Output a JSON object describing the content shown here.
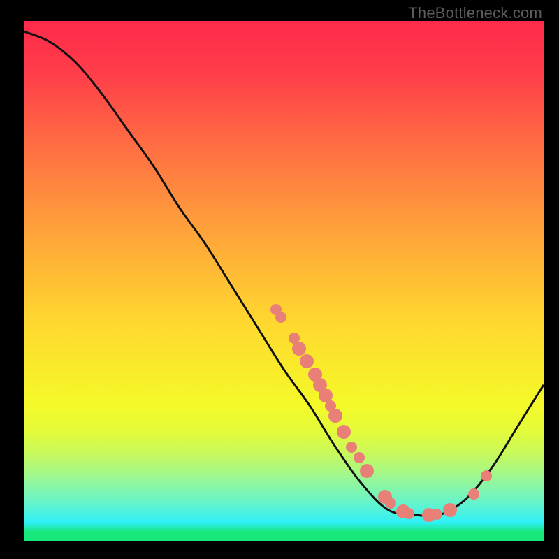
{
  "attribution": "TheBottleneck.com",
  "chart_data": {
    "type": "line",
    "title": "",
    "xlabel": "",
    "ylabel": "",
    "xlim": [
      0,
      100
    ],
    "ylim": [
      0,
      100
    ],
    "grid": false,
    "curve": [
      {
        "x": 0,
        "y": 98
      },
      {
        "x": 5,
        "y": 96
      },
      {
        "x": 10,
        "y": 92
      },
      {
        "x": 15,
        "y": 86
      },
      {
        "x": 20,
        "y": 79
      },
      {
        "x": 25,
        "y": 72
      },
      {
        "x": 30,
        "y": 64
      },
      {
        "x": 35,
        "y": 57
      },
      {
        "x": 40,
        "y": 49
      },
      {
        "x": 45,
        "y": 41
      },
      {
        "x": 50,
        "y": 33
      },
      {
        "x": 55,
        "y": 26
      },
      {
        "x": 60,
        "y": 18
      },
      {
        "x": 65,
        "y": 11
      },
      {
        "x": 70,
        "y": 6
      },
      {
        "x": 75,
        "y": 5
      },
      {
        "x": 80,
        "y": 5
      },
      {
        "x": 85,
        "y": 8
      },
      {
        "x": 90,
        "y": 14
      },
      {
        "x": 95,
        "y": 22
      },
      {
        "x": 100,
        "y": 30
      }
    ],
    "marker_clusters": [
      {
        "x": 48.5,
        "y": 44.5,
        "big": false
      },
      {
        "x": 49.5,
        "y": 43.0,
        "big": false
      },
      {
        "x": 52.0,
        "y": 39.0,
        "big": false
      },
      {
        "x": 53.0,
        "y": 37.0,
        "big": true
      },
      {
        "x": 54.5,
        "y": 34.5,
        "big": true
      },
      {
        "x": 56.0,
        "y": 32.0,
        "big": true
      },
      {
        "x": 57.0,
        "y": 30.0,
        "big": true
      },
      {
        "x": 58.0,
        "y": 28.0,
        "big": true
      },
      {
        "x": 59.0,
        "y": 26.0,
        "big": false
      },
      {
        "x": 60.0,
        "y": 24.0,
        "big": true
      },
      {
        "x": 61.5,
        "y": 21.0,
        "big": true
      },
      {
        "x": 63.0,
        "y": 18.0,
        "big": false
      },
      {
        "x": 64.5,
        "y": 16.0,
        "big": false
      },
      {
        "x": 66.0,
        "y": 13.5,
        "big": true
      },
      {
        "x": 69.5,
        "y": 8.5,
        "big": true
      },
      {
        "x": 70.5,
        "y": 7.2,
        "big": false
      },
      {
        "x": 73.0,
        "y": 5.6,
        "big": true
      },
      {
        "x": 74.0,
        "y": 5.2,
        "big": false
      },
      {
        "x": 78.0,
        "y": 5.0,
        "big": true
      },
      {
        "x": 79.5,
        "y": 5.1,
        "big": false
      },
      {
        "x": 82.0,
        "y": 5.9,
        "big": true
      },
      {
        "x": 86.5,
        "y": 9.0,
        "big": false
      },
      {
        "x": 89.0,
        "y": 12.5,
        "big": false
      }
    ]
  },
  "styling": {
    "curve_stroke": "#111111",
    "curve_width": 3,
    "marker_fill": "#e98077"
  },
  "labels": {
    "x_ticks": [],
    "y_ticks": []
  }
}
